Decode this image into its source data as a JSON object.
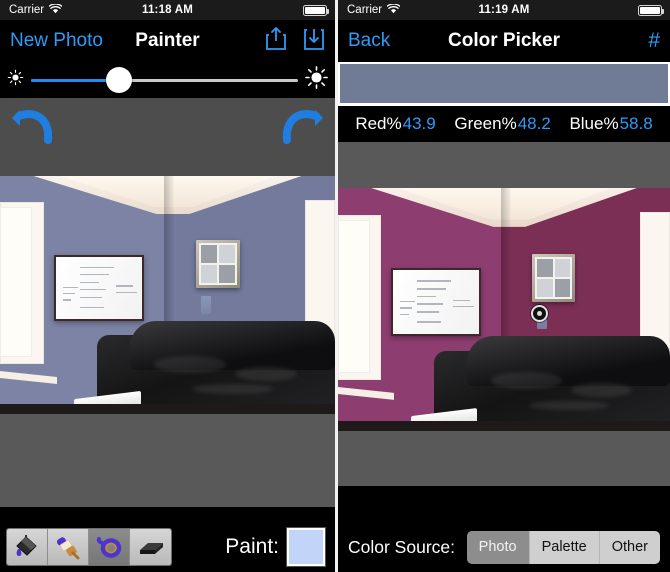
{
  "colors": {
    "accent_blue": "#2f9bf7",
    "picked_swatch": "#707b96",
    "paint_swatch": "#c2d4f7",
    "wall_left_original": "#7d83a4",
    "wall_right_original": "#737a9c",
    "wall_left_painted": "#8e3d70",
    "wall_right_painted": "#7c2f55",
    "toolbar_black": "#000000",
    "panel_gray": "#4d4d4d"
  },
  "left_screen": {
    "status": {
      "carrier": "Carrier",
      "wifi_icon": "wifi-icon",
      "time": "11:18 AM",
      "battery_icon": "battery-icon"
    },
    "nav": {
      "back_label": "New Photo",
      "title": "Painter",
      "share_icon": "share-icon",
      "save_icon": "download-icon"
    },
    "brightness": {
      "low_icon": "brightness-low-icon",
      "high_icon": "brightness-high-icon",
      "value_percent": 33
    },
    "history": {
      "undo_icon": "undo-arrow-icon",
      "redo_icon": "redo-arrow-icon"
    },
    "toolbar": {
      "tools": [
        {
          "name": "paint-bucket-tool",
          "selected": false
        },
        {
          "name": "paint-brush-tool",
          "selected": false
        },
        {
          "name": "lasso-select-tool",
          "selected": true
        },
        {
          "name": "eraser-tool",
          "selected": false
        }
      ],
      "paint_label": "Paint:",
      "paint_color": "#c2d4f7"
    }
  },
  "right_screen": {
    "status": {
      "carrier": "Carrier",
      "wifi_icon": "wifi-icon",
      "time": "11:19 AM",
      "battery_icon": "battery-icon"
    },
    "nav": {
      "back_label": "Back",
      "title": "Color Picker",
      "hex_label": "#"
    },
    "swatch": {
      "color": "#707b96"
    },
    "readout": {
      "red_label": "Red%",
      "red_value": "43.9",
      "green_label": "Green%",
      "green_value": "48.2",
      "blue_label": "Blue%",
      "blue_value": "58.8"
    },
    "picker": {
      "cursor_icon": "eyedropper-target-icon"
    },
    "source": {
      "label": "Color Source:",
      "options": [
        {
          "label": "Photo",
          "selected": true
        },
        {
          "label": "Palette",
          "selected": false
        },
        {
          "label": "Other",
          "selected": false
        }
      ]
    }
  }
}
